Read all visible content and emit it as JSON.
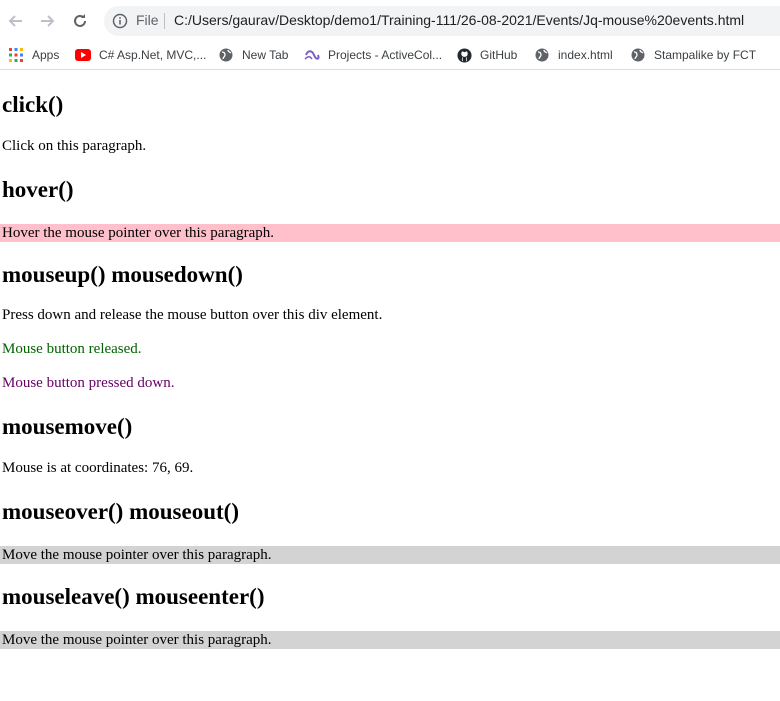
{
  "browser": {
    "file_label": "File",
    "url": "C:/Users/gaurav/Desktop/demo1/Training-111/26-08-2021/Events/Jq-mouse%20events.html",
    "bookmarks": [
      {
        "label": "Apps",
        "icon": "apps-grid-icon"
      },
      {
        "label": "C# Asp.Net, MVC,...",
        "icon": "youtube-icon"
      },
      {
        "label": "New Tab",
        "icon": "globe-icon"
      },
      {
        "label": "Projects - ActiveCol...",
        "icon": "activecollab-icon"
      },
      {
        "label": "GitHub",
        "icon": "github-icon"
      },
      {
        "label": "index.html",
        "icon": "globe-icon"
      },
      {
        "label": "Stampalike by FCT",
        "icon": "globe-icon"
      }
    ]
  },
  "page": {
    "sections": [
      {
        "heading": "click()",
        "text": "Click on this paragraph."
      },
      {
        "heading": "hover()",
        "text": "Hover the mouse pointer over this paragraph.",
        "bg": "#ffc0cb"
      },
      {
        "heading": "mouseup() mousedown()",
        "text": "Press down and release the mouse button over this div element.",
        "status_released": "Mouse button released.",
        "status_pressed": "Mouse button pressed down.",
        "released_color": "#006400",
        "pressed_color": "#660066"
      },
      {
        "heading": "mousemove()",
        "text": "Mouse is at coordinates: 76, 69."
      },
      {
        "heading": "mouseover() mouseout()",
        "text": "Move the mouse pointer over this paragraph.",
        "bg": "#d3d3d3"
      },
      {
        "heading": "mouseleave() mouseenter()",
        "text": "Move the mouse pointer over this paragraph.",
        "bg": "#d3d3d3"
      }
    ]
  }
}
